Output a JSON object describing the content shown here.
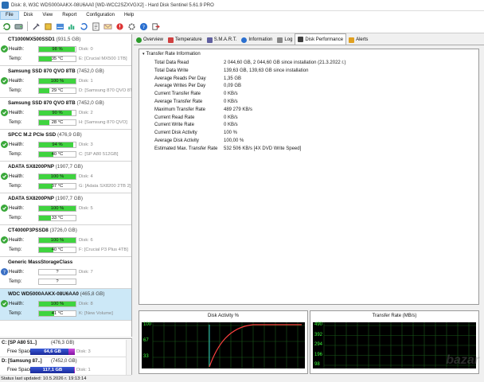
{
  "window": {
    "title": "Disk: 8, W3C WDS000AAKX-08U6AA0 [WD-WCC2SZXVGX2]  -  Hard Disk Sentinel 5.61.9 PRO"
  },
  "menu": [
    "File",
    "Disk",
    "View",
    "Report",
    "Configuration",
    "Help"
  ],
  "disks": [
    {
      "name": "CT1000MX500SSD1",
      "size": "(931,5 GB)",
      "health": "98 %",
      "health_pct": 98,
      "disk_no": "Disk: 0",
      "temp": "35 °C",
      "temp_pct": 35,
      "volume": "E: [Crucial MX500 1TB]",
      "status": "ok"
    },
    {
      "name": "Samsung SSD 870 QVO 8TB",
      "size": "(7452,0 GB)",
      "health": "100 %",
      "health_pct": 100,
      "disk_no": "Disk: 1",
      "temp": "29 °C",
      "temp_pct": 29,
      "volume": "D: [Samsung 870 QVO 8TB]",
      "status": "ok"
    },
    {
      "name": "Samsung SSD 870 QVO 8TB",
      "size": "(7452,0 GB)",
      "health": "90 %",
      "health_pct": 90,
      "disk_no": "Disk: 2",
      "temp": "28 °C",
      "temp_pct": 28,
      "volume": "H: [Samsung 870 QVO]",
      "status": "ok"
    },
    {
      "name": "SPCC M.2 PCIe SSD",
      "size": "(476,9 GB)",
      "health": "94 %",
      "health_pct": 94,
      "disk_no": "Disk: 3",
      "temp": "40 °C",
      "temp_pct": 40,
      "volume": "C: [SP A80 512GB]",
      "status": "ok"
    },
    {
      "name": "ADATA SX8200PNP",
      "size": "(1907,7 GB)",
      "health": "100 %",
      "health_pct": 100,
      "disk_no": "Disk: 4",
      "temp": "37 °C",
      "temp_pct": 37,
      "volume": "G: [Adata SX8200 2TB 2]",
      "status": "ok"
    },
    {
      "name": "ADATA SX8200PNP",
      "size": "(1907,7 GB)",
      "health": "100 %",
      "health_pct": 100,
      "disk_no": "Disk: 5",
      "temp": "33 °C",
      "temp_pct": 33,
      "volume": "",
      "status": "ok"
    },
    {
      "name": "CT4000P3PSSD8",
      "size": "(3726,0 GB)",
      "health": "100 %",
      "health_pct": 100,
      "disk_no": "Disk: 6",
      "temp": "40 °C",
      "temp_pct": 40,
      "volume": "F: [Crucial P3 Plus 4TB]",
      "status": "ok"
    },
    {
      "name": "Generic MassStorageClass",
      "size": "",
      "health": "?",
      "health_pct": 0,
      "disk_no": "Disk: 7",
      "temp": "?",
      "temp_pct": 0,
      "volume": "",
      "status": "unknown"
    },
    {
      "name": "WDC WD5000AAKX-08U6AA0",
      "size": "(465,8 GB)",
      "health": "100 %",
      "health_pct": 100,
      "disk_no": "Disk: 8",
      "temp": "41 °C",
      "temp_pct": 41,
      "volume": "K: [New Volume]",
      "status": "ok",
      "selected": true
    }
  ],
  "volumes": [
    {
      "name": "C: [SP A80 51..]",
      "size": "(476,3 GB)",
      "free_label": "Free Space",
      "free": "64,6 GB",
      "used_fraction": 0.86,
      "disk": "Disk: 3"
    },
    {
      "name": "D: [Samsung 87..]",
      "size": "(7452,0 GB)",
      "free_label": "Free Space",
      "free": "117,1 GB",
      "used_fraction": 0.98,
      "disk": "Disk: 1"
    }
  ],
  "statusbar": {
    "text": "Status last updated: 10.5.2026 г. 19:13:14"
  },
  "tabs": [
    {
      "label": "Overview",
      "icon": "check-icon"
    },
    {
      "label": "Temperature",
      "icon": "thermometer-icon"
    },
    {
      "label": "S.M.A.R.T.",
      "icon": "chip-icon"
    },
    {
      "label": "Information",
      "icon": "info-icon"
    },
    {
      "label": "Log",
      "icon": "log-icon"
    },
    {
      "label": "Disk Performance",
      "icon": "disk-icon",
      "active": true
    },
    {
      "label": "Alerts",
      "icon": "alert-icon"
    }
  ],
  "transfer": {
    "header": "Transfer Rate Information",
    "rows": [
      {
        "k": "Total Data Read",
        "v": "2 044,60 GB,  2 044,60 GB since installation  (21.3.2022 г.)"
      },
      {
        "k": "Total Data Write",
        "v": "139,63 GB,  139,63 GB since installation"
      },
      {
        "k": "Average Reads Per Day",
        "v": "1,35 GB"
      },
      {
        "k": "Average Writes Per Day",
        "v": "0,09 GB"
      },
      {
        "k": "Current Transfer Rate",
        "v": "0 KB/s"
      },
      {
        "k": "Average Transfer Rate",
        "v": "0 KB/s"
      },
      {
        "k": "Maximum Transfer Rate",
        "v": "489 279 KB/s"
      },
      {
        "k": "Current Read Rate",
        "v": "0 KB/s"
      },
      {
        "k": "Current Write Rate",
        "v": "0 KB/s"
      },
      {
        "k": "Current Disk Activity",
        "v": "100 %"
      },
      {
        "k": "Average Disk Activity",
        "v": "100,00 %"
      },
      {
        "k": "Estimated Max. Transfer Rate",
        "v": "532 506 KB/s [4X DVD Write Speed]"
      }
    ]
  },
  "graphs": {
    "activity": {
      "title": "Disk Activity %",
      "ticks": [
        "100",
        "67",
        "33"
      ]
    },
    "rate": {
      "title": "Transfer Rate (MB/s)",
      "ticks": [
        "490",
        "392",
        "294",
        "196",
        "98"
      ]
    }
  },
  "watermark": "bazar",
  "colors": {
    "health_bar": "#3fd43f",
    "temp_bar": "#3fd43f",
    "graph_line": "#ff4040",
    "graph_bg": "#000000",
    "grid": "#3cff3c"
  }
}
